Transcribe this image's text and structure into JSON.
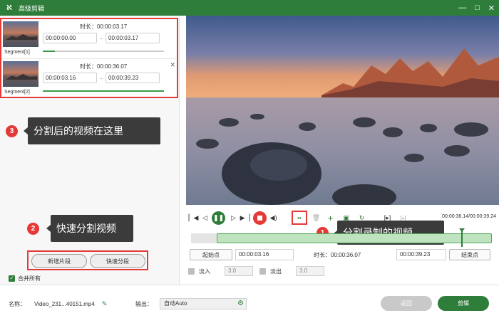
{
  "window": {
    "title": "高级剪辑",
    "minimize": "—",
    "maximize": "□",
    "close": "✕",
    "logo": "ℵ"
  },
  "segments": [
    {
      "label": "Segment[1]",
      "duration_label": "时长：00:00:03.17",
      "start": "00:00:00.00",
      "end": "00:00:03.17",
      "progress": 0.1,
      "dash": "–"
    },
    {
      "label": "Segment[2]",
      "duration_label": "时长：00:00:36.07",
      "start": "00:00:03.16",
      "end": "00:00:39.23",
      "progress": 1.0,
      "dash": "–",
      "close": "✕"
    }
  ],
  "callouts": {
    "c1": {
      "num": "1",
      "text": "分割录制的视频"
    },
    "c2": {
      "num": "2",
      "text": "快速分割视频"
    },
    "c3": {
      "num": "3",
      "text": "分割后的视频在这里"
    }
  },
  "left_buttons": {
    "new_segment": "新增片段",
    "quick_split": "快速分段"
  },
  "merge_all": {
    "label": "合并所有",
    "checked": true,
    "check": "✓"
  },
  "controls": {
    "time_readout": "00:00:36.14/00:00:39.24",
    "icons": [
      "prev-icon",
      "step-back-icon",
      "pause-icon",
      "step-forward-icon",
      "next-icon",
      "stop-icon",
      "volume-icon",
      "split-icon",
      "delete-icon",
      "add-icon",
      "copy-icon",
      "rotate-icon",
      "crop-left-icon",
      "crop-right-icon"
    ]
  },
  "trim": {
    "start_label": "起始点",
    "start_value": "00:00:03.16",
    "duration_label": "时长：00:00:36.07",
    "end_value": "00:00:39.23",
    "end_label": "结束点"
  },
  "fade": {
    "in_label": "淡入",
    "in_value": "3.0",
    "out_label": "淡出",
    "out_value": "3.0"
  },
  "bottom": {
    "name_label": "名称：",
    "name_value": "Video_231...40151.mp4",
    "output_label": "输出：",
    "output_value": "自动Auto",
    "back_button": "返回",
    "ok_button": "剪辑"
  },
  "colors": {
    "brand": "#2f7d3a",
    "highlight": "#e53935",
    "callout_bg": "#3b3b3b"
  }
}
